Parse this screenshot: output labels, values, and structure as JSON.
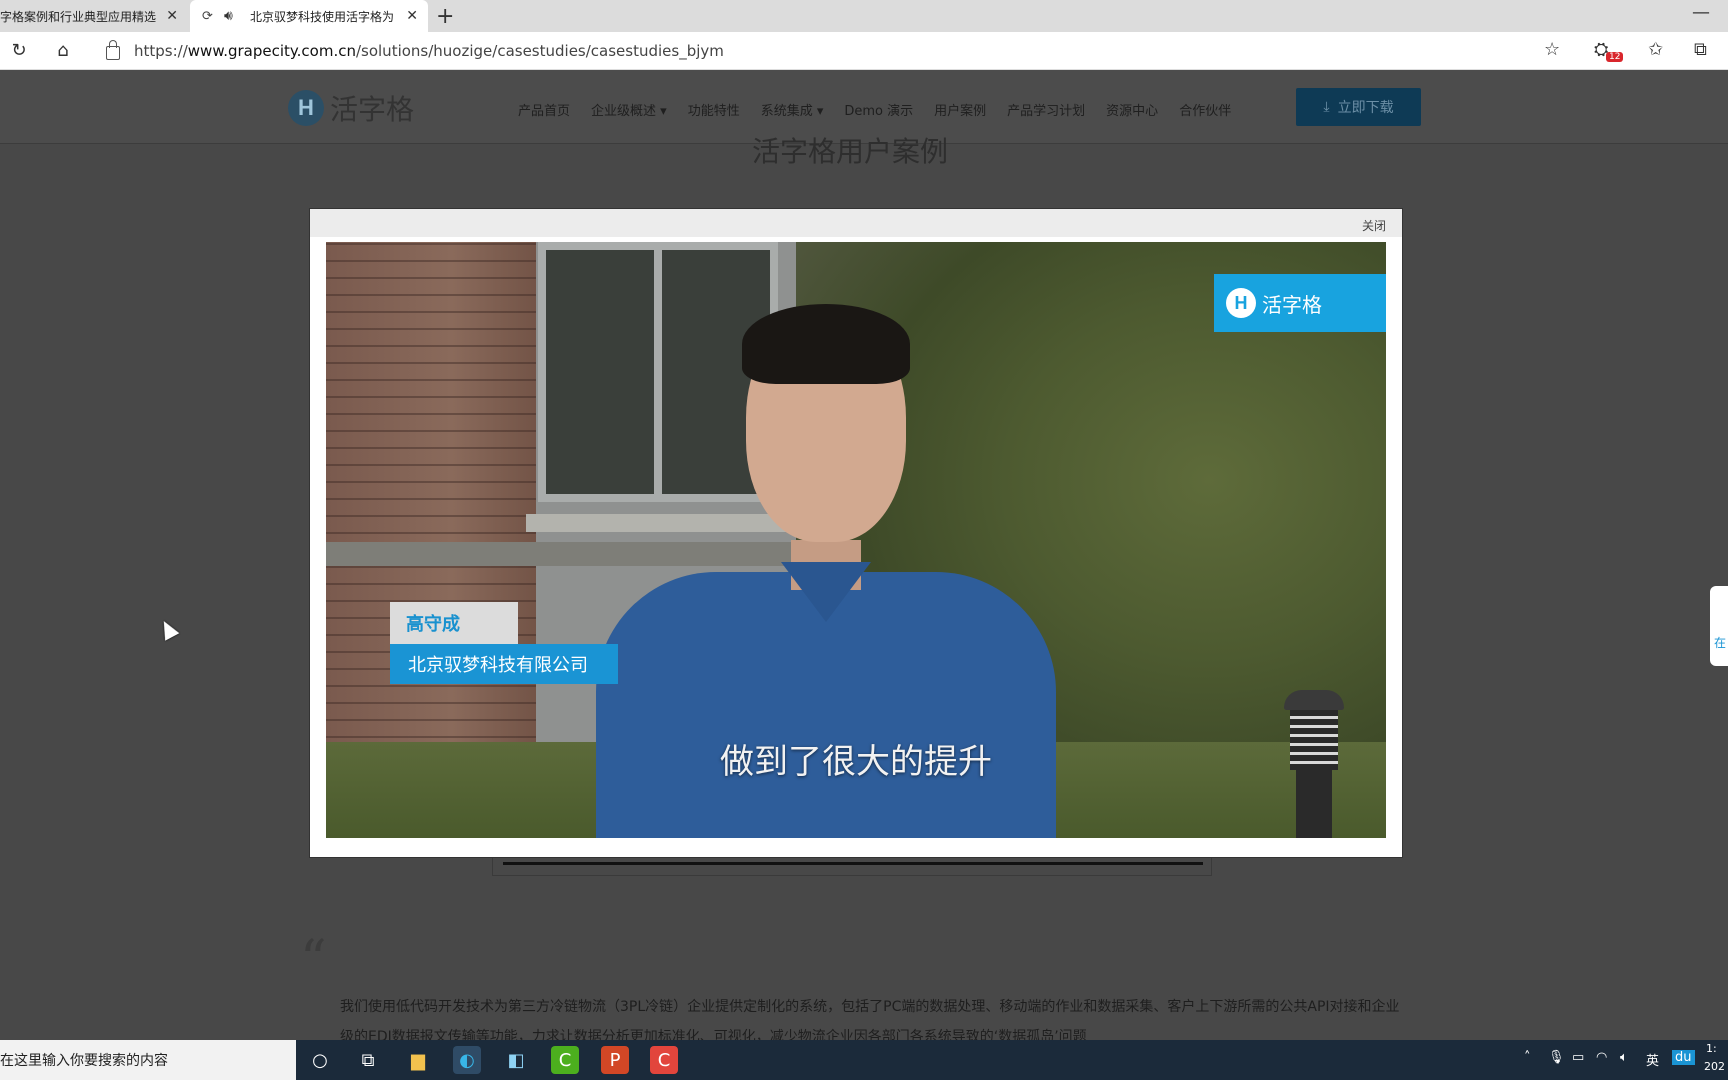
{
  "browser": {
    "tabs": [
      {
        "title": "字格案例和行业典型应用精选"
      },
      {
        "title": "北京驭梦科技使用活字格为"
      }
    ],
    "url_prefix": "https://",
    "url_domain": "www.grapecity.com.cn",
    "url_path": "/solutions/huozige/casestudies/casestudies_bjym",
    "notification_count": "12"
  },
  "site": {
    "logo_text": "活字格",
    "logo_mark": "H",
    "nav": [
      "产品首页",
      "企业级概述 ▾",
      "功能特性",
      "系统集成 ▾",
      "Demo 演示",
      "用户案例",
      "产品学习计划",
      "资源中心",
      "合作伙伴"
    ],
    "download_label": "立即下载",
    "page_title": "活字格用户案例",
    "quote_mark": "“",
    "body_text": "我们使用低代码开发技术为第三方冷链物流（3PL冷链）企业提供定制化的系统，包括了PC端的数据处理、移动端的作业和数据采集、客户上下游所需的公共API对接和企业级的EDI数据报文传输等功能，力求让数据分析更加标准化、可视化，减少物流企业因各部门各系统导致的‘数据孤岛’问题"
  },
  "modal": {
    "close_label": "关闭",
    "video": {
      "brand_text": "活字格",
      "brand_mark": "H",
      "person_name": "高守成",
      "company": "北京驭梦科技有限公司",
      "subtitle": "做到了很大的提升"
    }
  },
  "side_tab": "在",
  "taskbar": {
    "search_placeholder": "在这里输入你要搜索的内容",
    "tray_lang": "英",
    "tray_clock": "1:",
    "tray_date": "202"
  },
  "colors": {
    "brand_blue": "#18a3df",
    "overlay": "#484848",
    "download_button": "#0e3a55"
  }
}
